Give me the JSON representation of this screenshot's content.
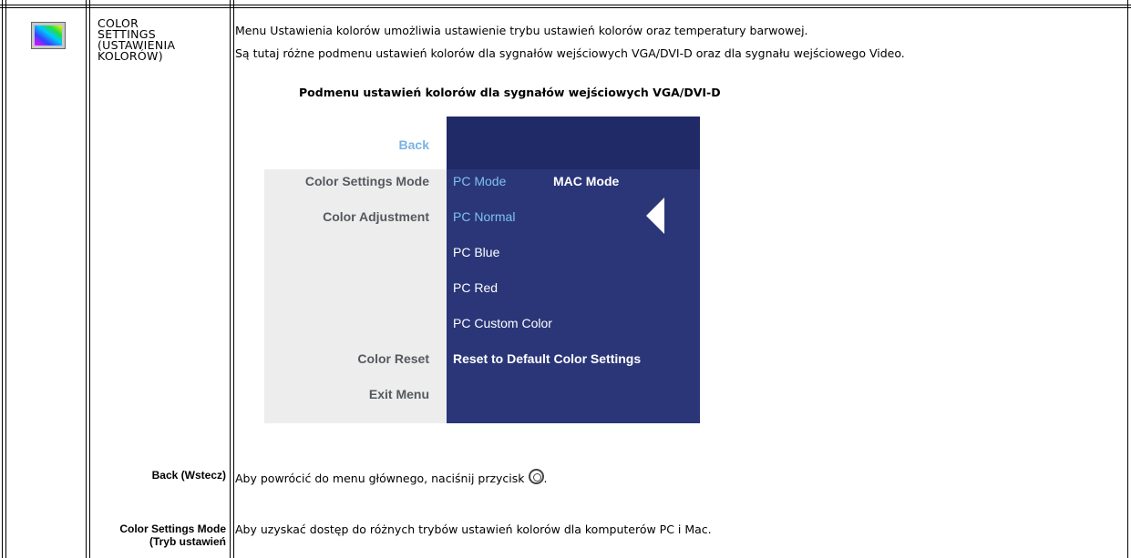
{
  "section": {
    "title_lines": [
      "COLOR",
      "SETTINGS",
      "(USTAWIENIA",
      "KOLORÓW)"
    ],
    "icon": "color-settings-icon"
  },
  "intro": {
    "line1": "Menu Ustawienia kolorów umożliwia ustawienie trybu ustawień kolorów oraz temperatury barwowej.",
    "line2": "Są tutaj różne podmenu ustawień kolorów dla sygnałów wejściowych VGA/DVI-D oraz dla sygnału wejściowego Video."
  },
  "submenu_title": "Podmenu ustawień kolorów dla sygnałów wejściowych VGA/DVI-D",
  "osd": {
    "left_items": [
      "Back",
      "Color Settings Mode",
      "Color Adjustment",
      "Color Reset",
      "Exit Menu"
    ],
    "pc_mode": "PC Mode",
    "mac_mode": "MAC Mode",
    "adjust_options": [
      "PC Normal",
      "PC Blue",
      "PC Red",
      "PC Custom Color"
    ],
    "reset_default": "Reset to Default Color Settings",
    "colors": {
      "panel_dark": "#2a3678",
      "panel_top": "#1f2a66",
      "highlight": "#7ec1ef",
      "left_bg": "#ededed"
    }
  },
  "rows": [
    {
      "label": "Back (Wstecz)",
      "desc": "Aby powrócić do menu głównego, naciśnij przycisk",
      "desc_suffix": ".",
      "icon": "menu-button-icon"
    },
    {
      "label_lines": [
        "Color Settings Mode",
        "(Tryb ustawień"
      ],
      "desc": "Aby uzyskać dostęp do różnych trybów ustawień kolorów dla komputerów PC i Mac."
    }
  ]
}
